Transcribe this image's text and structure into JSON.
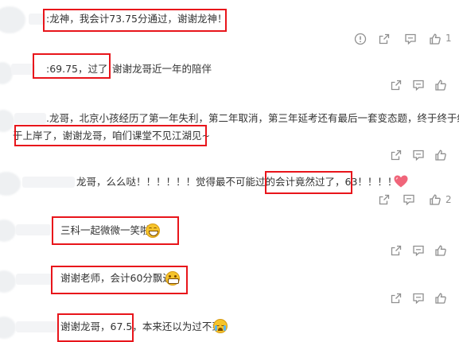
{
  "comments": [
    {
      "text": ":龙神，我会计73.75分通过，谢谢龙神！",
      "likes": "1"
    },
    {
      "prefix": ":69.75，过了!",
      "text": "谢谢龙哥近一年的陪伴"
    },
    {
      "line1": ".龙哥，北京小孩经历了第一年失利，第二年取消，第三年延考还有最后一套变态题，终于终于终",
      "line2": "于上岸了，谢谢龙哥，咱们课堂不见江湖见~"
    },
    {
      "text": "龙哥，么么哒！！！！！！觉得最不可能过的会计竟然过了，63！！！！！",
      "likes": "2"
    },
    {
      "text": "三科一起微微一笑啦"
    },
    {
      "text": "谢谢老师，会计60分飘过"
    },
    {
      "text": "谢谢龙哥，67.5，本来还以为过不到"
    }
  ],
  "icons": {
    "report": "warning-icon",
    "share": "share-icon",
    "comment": "comment-icon",
    "like": "thumb-up-icon"
  },
  "colors": {
    "highlight": "#e8151b",
    "text": "#333333",
    "icon": "#8f8f8f"
  }
}
